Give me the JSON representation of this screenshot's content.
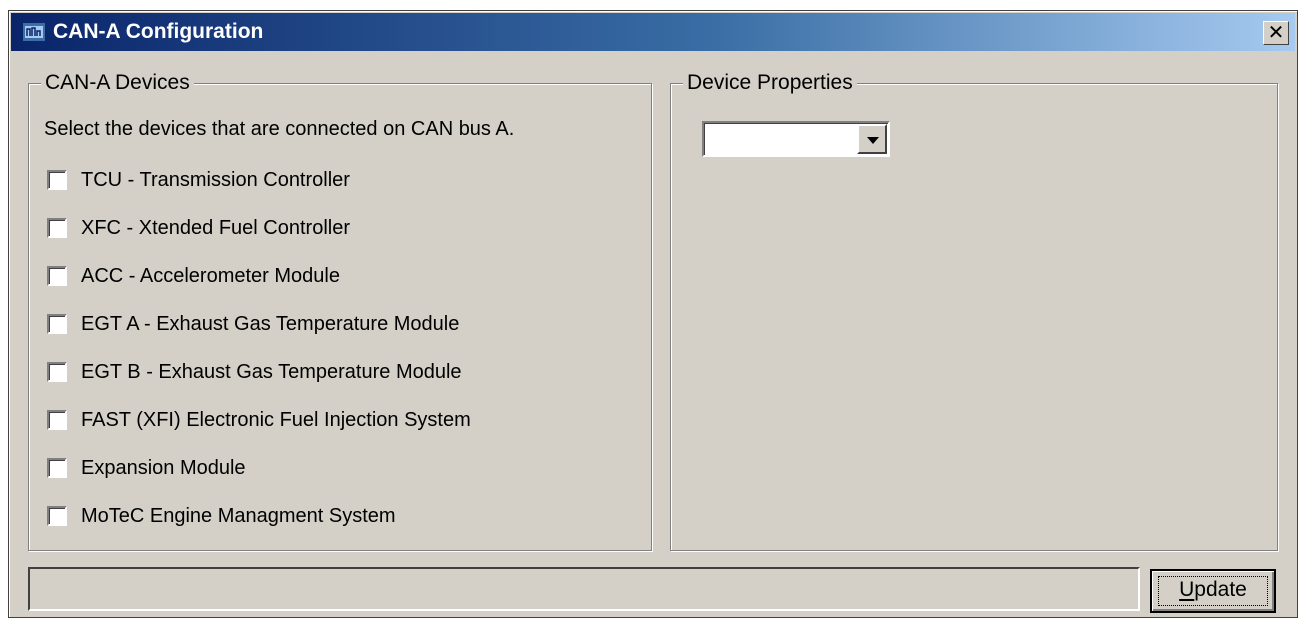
{
  "window": {
    "title": "CAN-A Configuration",
    "close_glyph": "✕",
    "icon": "app-icon"
  },
  "devices_group": {
    "legend": "CAN-A Devices",
    "instruction": "Select the devices that are connected on CAN bus A.",
    "items": [
      {
        "label": "TCU - Transmission Controller",
        "checked": false
      },
      {
        "label": "XFC - Xtended Fuel Controller",
        "checked": false
      },
      {
        "label": "ACC - Accelerometer Module",
        "checked": false
      },
      {
        "label": "EGT A - Exhaust Gas Temperature Module",
        "checked": false
      },
      {
        "label": "EGT B - Exhaust Gas Temperature Module",
        "checked": false
      },
      {
        "label": "FAST (XFI) Electronic Fuel Injection System",
        "checked": false
      },
      {
        "label": "Expansion Module",
        "checked": false
      },
      {
        "label": "MoTeC Engine Managment System",
        "checked": false
      }
    ]
  },
  "properties_group": {
    "legend": "Device Properties",
    "dropdown_value": ""
  },
  "footer": {
    "status_text": "",
    "update_label": "Update"
  },
  "colors": {
    "face": "#d4d0c8",
    "title_start": "#0a246a",
    "title_end": "#a6caf0"
  }
}
